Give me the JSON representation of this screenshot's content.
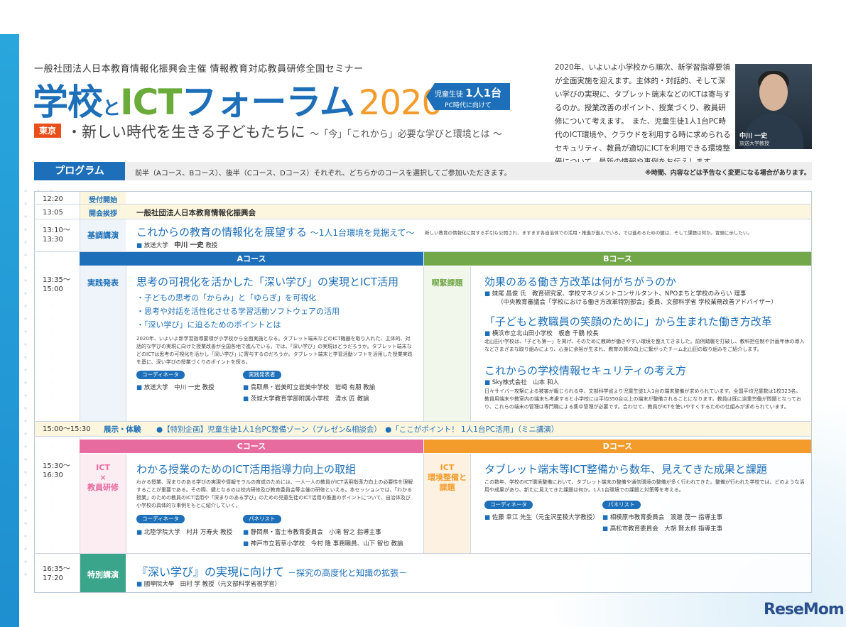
{
  "header": {
    "subtitle": "一般社団法人日本教育情報化振興会主催 情報教育対応教員研修全国セミナー",
    "title_gakko": "学校",
    "title_to": "と",
    "title_ict": "ICT",
    "title_forum": "フォーラム",
    "title_year": "2020",
    "tag_line1_prefix": "児童生徒",
    "tag_line1_main": "1人1台",
    "tag_line2": "PC時代に向けて",
    "location": "東京",
    "tagline_main": "・新しい時代を生きる子どもたちに",
    "tagline_sub": "～「今」「これから」必要な学びと環境とは ～"
  },
  "intro": {
    "text": "2020年、いよいよ小学校から順次、新学習指導要領が全面実施を迎えます。主体的・対話的、そして深い学びの実現に、タブレット端末などのICTは寄与するのか。授業改善のポイント、授業づくり、教員研修について考えます。　また、児童生徒1人1台PC時代のICT環境や、クラウドを利用する時に求められるセキュリティ、教員が適切にICTを利用できる環境整備について、最新の情報や事例をお伝えします。",
    "photo_name": "中川 一史",
    "photo_affil": "放送大学教授"
  },
  "program": {
    "label": "プログラム",
    "desc": "前半（Aコース、Bコース）、後半（Cコース、Dコース）それぞれ、どちらかのコースを選択してご参加いただきます。",
    "note": "※時間、内容などは予告なく変更になる場合があります。"
  },
  "rows": {
    "reception": {
      "time": "12:20",
      "label": "受付開始"
    },
    "opening": {
      "time": "13:05",
      "label": "開会挨拶",
      "content": "一般社団法人日本教育情報化振興会"
    },
    "keynote": {
      "time1": "13:10～",
      "time2": "13:30",
      "label": "基調講演",
      "title": "これからの教育の情報化を展望する",
      "title_sub": "～1人1台環境を見据えて～",
      "desc": "新しい教育の情報化に関する手引も公開され、ますます各自治体での活用・推進が進んでいる。では進めるための鍵は、そして課題は何か。冒頭に示したい。",
      "speaker_affil": "放送大学",
      "speaker_name": "中川 一史",
      "speaker_role": "教授"
    },
    "courseAB": {
      "time1": "13:35～",
      "time2": "15:00",
      "a_header": "Aコース",
      "b_header": "Bコース",
      "a_label": "実践発表",
      "b_label": "喫緊課題",
      "a_title": "思考の可視化を活かした「深い学び」の実現とICT活用",
      "a_bullets": [
        "・子どもの思考の「からみ」と「ゆらぎ」を可視化",
        "・思考や対話を活性化させる学習活動ソフトウェアの活用",
        "・「深い学び」に迫るためのポイントとは"
      ],
      "a_body": "2020年、いよいよ新学習指導要領が小学校から全面実施となる。タブレット端末などのICT機器を取り入れた、主体的、対話的な学びの実現に向けた授業改善が全国各地で進んでいる。では、「深い学び」の実現はどうだろうか。タブレット端末などのICTは思考の可視化を活かし「深い学び」に寄与するのだろうか。タブレット端末と学習活動ソフトを活用した授業実践を基に、深い学びの授業づくりのポイントを探る。",
      "a_coord_pill": "コーディネータ",
      "a_coord": "放送大学　中川 一史 教授",
      "a_pres_pill": "実践発表者",
      "a_pres1": "鳥取県・岩美町立岩美中学校　岩﨑 有朋 教諭",
      "a_pres2": "茨城大学教育学部附属小学校　清水 匠 教諭",
      "b_t1": "効果のある働き方改革は何がちがうのか",
      "b_s1a": "妹尾 昌俊 氏　教育研究家、学校マネジメントコンサルタント、NPOまちと学校のみらい 理事",
      "b_s1b": "（中央教育審議会「学校における働き方改革特別部会」委員、文部科学省 学校業務改善アドバイザー）",
      "b_t2": "「子どもと教職員の笑顔のために」から生まれた働き方改革",
      "b_s2": "横浜市立北山田小学校　板倉 千鶴 校長",
      "b_b2": "北山田小学校は、「子ども第一」を掲げ、そのために教師が働きやすい環境を整えてきました。前例踏襲を打破し、教科担任制や計画年休の導入などさまざまな取り組みにより、心身に余裕が生まれ、教育の質の向上に繋がったチーム北山田の取り組みをご紹介します。",
      "b_t3": "これからの学校情報セキュリティの考え方",
      "b_s3": "Sky株式会社　山本 和人",
      "b_b3": "日々サイバー攻撃による被害が報じられる中、文部科学省より児童生徒1人1台の端末整備が求められています。全国平均児童数は1校323名。教員用端末や教室内の端末も考慮すると小学校には平均350台以上の端末が整備されることになります。教員は既に過重労働が問題となっており、これらの端末の管理は専門職による集中管理が必要です。合わせて、教員がICTを使いやすくするための仕組みが求められています。"
    },
    "exhibit": {
      "time": "15:00～15:30",
      "label": "展示・体験",
      "content": "●【特別企画】児童生徒1人1台PC整備ゾーン（プレゼン&相談会）　●「ここがポイント！ 1人1台PC活用」（ミニ講演）"
    },
    "courseCD": {
      "time1": "15:30～",
      "time2": "16:30",
      "c_header": "Cコース",
      "d_header": "Dコース",
      "c_label1": "ICT",
      "c_label2": "×",
      "c_label3": "教員研修",
      "d_label1": "ICT",
      "d_label2": "環境整備と",
      "d_label3": "課題",
      "c_title": "わかる授業のためのICT活用指導力向上の取組",
      "c_body": "わかる授業、深まりのある学びの実現や情報モラルの育成のためには、一人一人の教員がICT活用指導力向上の必要性を理解することが重要である。その際、鍵となるのは校内研修及び教育委員会等主催の研修といえる。本セッションでは、「わかる授業」のための教員のICT活用や「深まりのある学び」のための児童生徒のICT活用の推進のポイントについて、自治体及び小学校の具体的な事例をもとに紹介していく。",
      "c_coord_pill": "コーディネータ",
      "c_coord": "北陸学院大学　村井 万寿夫 教授",
      "c_pan_pill": "パネリスト",
      "c_pan1": "静岡県・富士市教育委員会　小滝 智之 指導主事",
      "c_pan2": "神戸市立若草小学校　今村 隆 事務職員、山下 智也 教諭",
      "d_title": "タブレット端末等ICT整備から数年、見えてきた成果と課題",
      "d_body": "この数年、学校のICT環境整備において、タブレット端末の整備や通信環境の整備が多く行われてきた。整備が行われた学校では、どのような活用や成果があり、新たに見えてきた課題は何か。1人1台環境での課題と対策等を考える。",
      "d_coord_pill": "コーディネータ",
      "d_coord": "佐藤 幸江 先生（元金沢星稜大学教授）",
      "d_pan_pill": "パネリスト",
      "d_pan1": "相模原市教育委員会　渡邉 茂一 指導主事",
      "d_pan2": "高松市教育委員会　大胡 賢太郎 指導主事"
    },
    "special": {
      "time1": "16:35～",
      "time2": "17:20",
      "label": "特別講演",
      "title": "『深い学び』の実現に向けて",
      "title_sub": "－探究の高度化と知識の拡張－",
      "speaker": "國學院大學　田村 学 教授（元文部科学省視学官）"
    }
  },
  "logo": "ReseMom"
}
